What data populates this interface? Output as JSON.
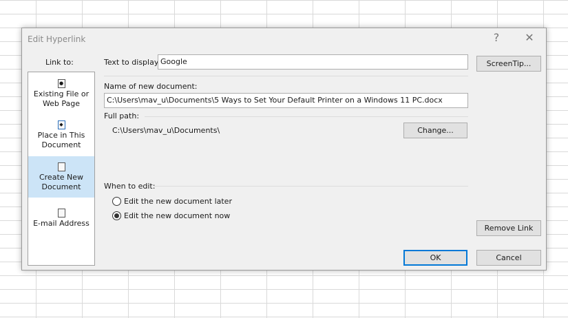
{
  "dialog": {
    "title": "Edit Hyperlink",
    "help": "?",
    "close": "✕"
  },
  "link_to": {
    "label": "Link to:",
    "items": [
      {
        "label1": "Existing File or",
        "label2": "Web Page",
        "icon": "globe-file-icon"
      },
      {
        "label1": "Place in This",
        "label2": "Document",
        "icon": "place-document-icon"
      },
      {
        "label1": "Create New",
        "label2": "Document",
        "icon": "new-document-icon",
        "selected": true
      },
      {
        "label1": "E-mail Address",
        "label2": "",
        "icon": "email-icon"
      }
    ]
  },
  "text_to_display": {
    "label": "Text to display:",
    "value": "Google"
  },
  "screentip": "ScreenTip...",
  "new_doc": {
    "label": "Name of new document:",
    "value": "C:\\Users\\mav_u\\Documents\\5 Ways to Set Your Default Printer on a Windows 11 PC.docx"
  },
  "full_path": {
    "label": "Full path:",
    "value": "C:\\Users\\mav_u\\Documents\\"
  },
  "change": "Change...",
  "when_to_edit": {
    "label": "When to edit:",
    "options": [
      {
        "label": "Edit the new document later",
        "selected": false
      },
      {
        "label": "Edit the new document now",
        "selected": true
      }
    ]
  },
  "remove_link": "Remove Link",
  "ok": "OK",
  "cancel": "Cancel"
}
